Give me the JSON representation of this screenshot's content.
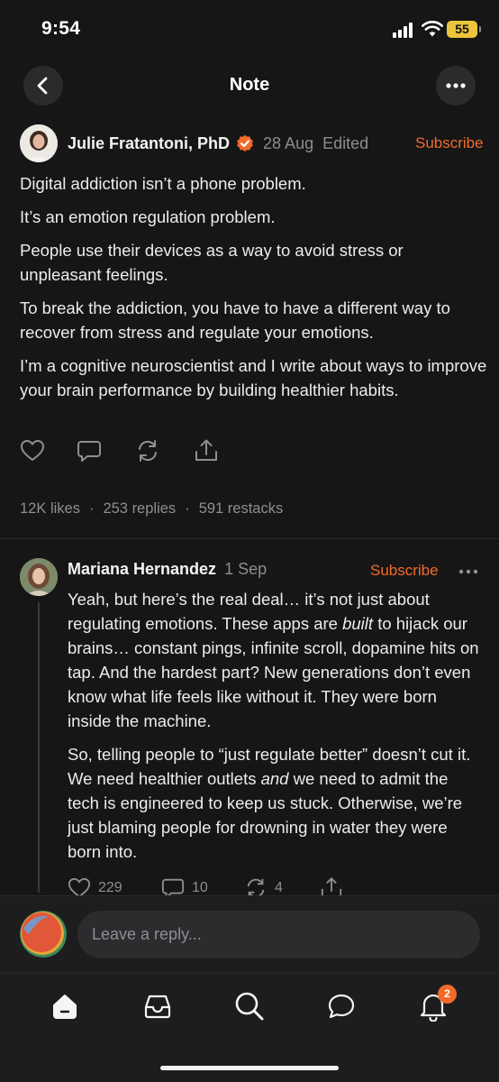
{
  "status_bar": {
    "time": "9:54",
    "battery": "55"
  },
  "header": {
    "title": "Note",
    "back_icon": "chevron-left-icon",
    "more_icon": "ellipsis-icon"
  },
  "post": {
    "author": "Julie Fratantoni, PhD",
    "verified": true,
    "date": "28 Aug",
    "edited": "Edited",
    "subscribe_label": "Subscribe",
    "paragraphs": [
      "Digital addiction isn’t a phone problem.",
      "It’s an emotion regulation problem.",
      "People use their devices as a way to avoid stress or unpleasant feelings.",
      "To break the addiction, you have to have a different way to recover from stress and regulate your emotions.",
      "I’m a cognitive neuroscientist and I write about ways to improve your brain performance by building healthier habits."
    ],
    "actions": [
      "heart-icon",
      "comment-icon",
      "restack-icon",
      "share-icon"
    ],
    "stats": {
      "likes": "12K likes",
      "replies": "253 replies",
      "restacks": "591 restacks"
    }
  },
  "reply": {
    "author": "Mariana Hernandez",
    "date": "1 Sep",
    "subscribe_label": "Subscribe",
    "p1_a": "Yeah, but here’s the real deal… it’s not just about regulating emotions. These apps are ",
    "p1_em": "built",
    "p1_b": " to hijack our brains… constant pings, infinite scroll, dopamine hits on tap. And the hardest part? New generations don’t even know what life feels like without it. They were born inside the machine.",
    "p2_a": "So, telling people to “just regulate better” doesn’t cut it. We need healthier outlets ",
    "p2_em": "and",
    "p2_b": " we need to admit the tech is engineered to keep us stuck. Otherwise, we’re just blaming people for drowning in water they were born into.",
    "likes": "229",
    "comments": "10",
    "restacks": "4"
  },
  "composer": {
    "placeholder": "Leave a reply..."
  },
  "tabbar": {
    "items": [
      "home-icon",
      "inbox-icon",
      "search-icon",
      "chat-icon",
      "bell-icon"
    ],
    "notification_count": "2"
  },
  "colors": {
    "accent": "#f26a2b",
    "background": "#161617",
    "battery": "#ebc53b"
  }
}
